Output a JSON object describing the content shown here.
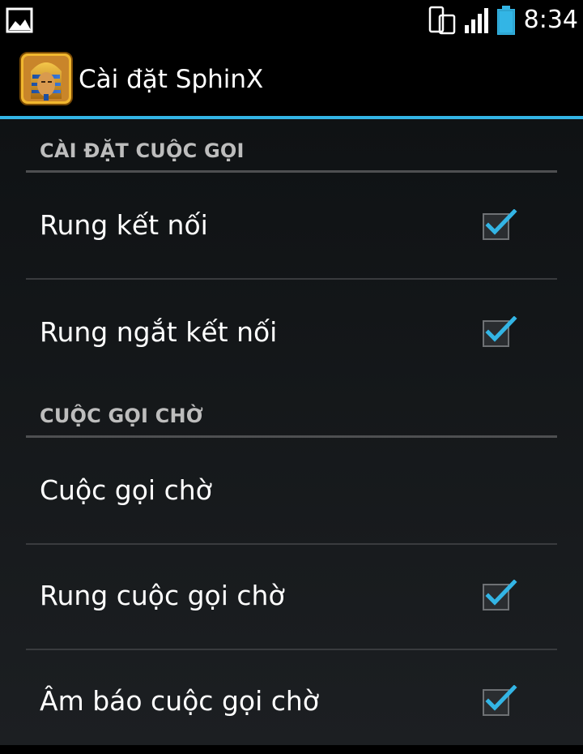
{
  "status_bar": {
    "time": "8:34",
    "icons": [
      "gallery-icon",
      "phone-rotate-icon",
      "signal-icon",
      "battery-icon"
    ]
  },
  "action_bar": {
    "app_icon": "sphinx-app-icon",
    "title": "Cài đặt SphinX"
  },
  "colors": {
    "accent": "#33b5e5",
    "checkmark": "#33b5e5"
  },
  "sections": [
    {
      "header": "CÀI ĐẶT CUỘC GỌI",
      "items": [
        {
          "label": "Rung kết nối",
          "checked": true
        },
        {
          "label": "Rung ngắt kết nối",
          "checked": true
        }
      ]
    },
    {
      "header": "CUỘC GỌI CHỜ",
      "items": [
        {
          "label": "Cuộc gọi chờ",
          "checked": null
        },
        {
          "label": "Rung cuộc gọi chờ",
          "checked": true
        },
        {
          "label": "Âm báo cuộc gọi chờ",
          "checked": true
        }
      ]
    }
  ]
}
